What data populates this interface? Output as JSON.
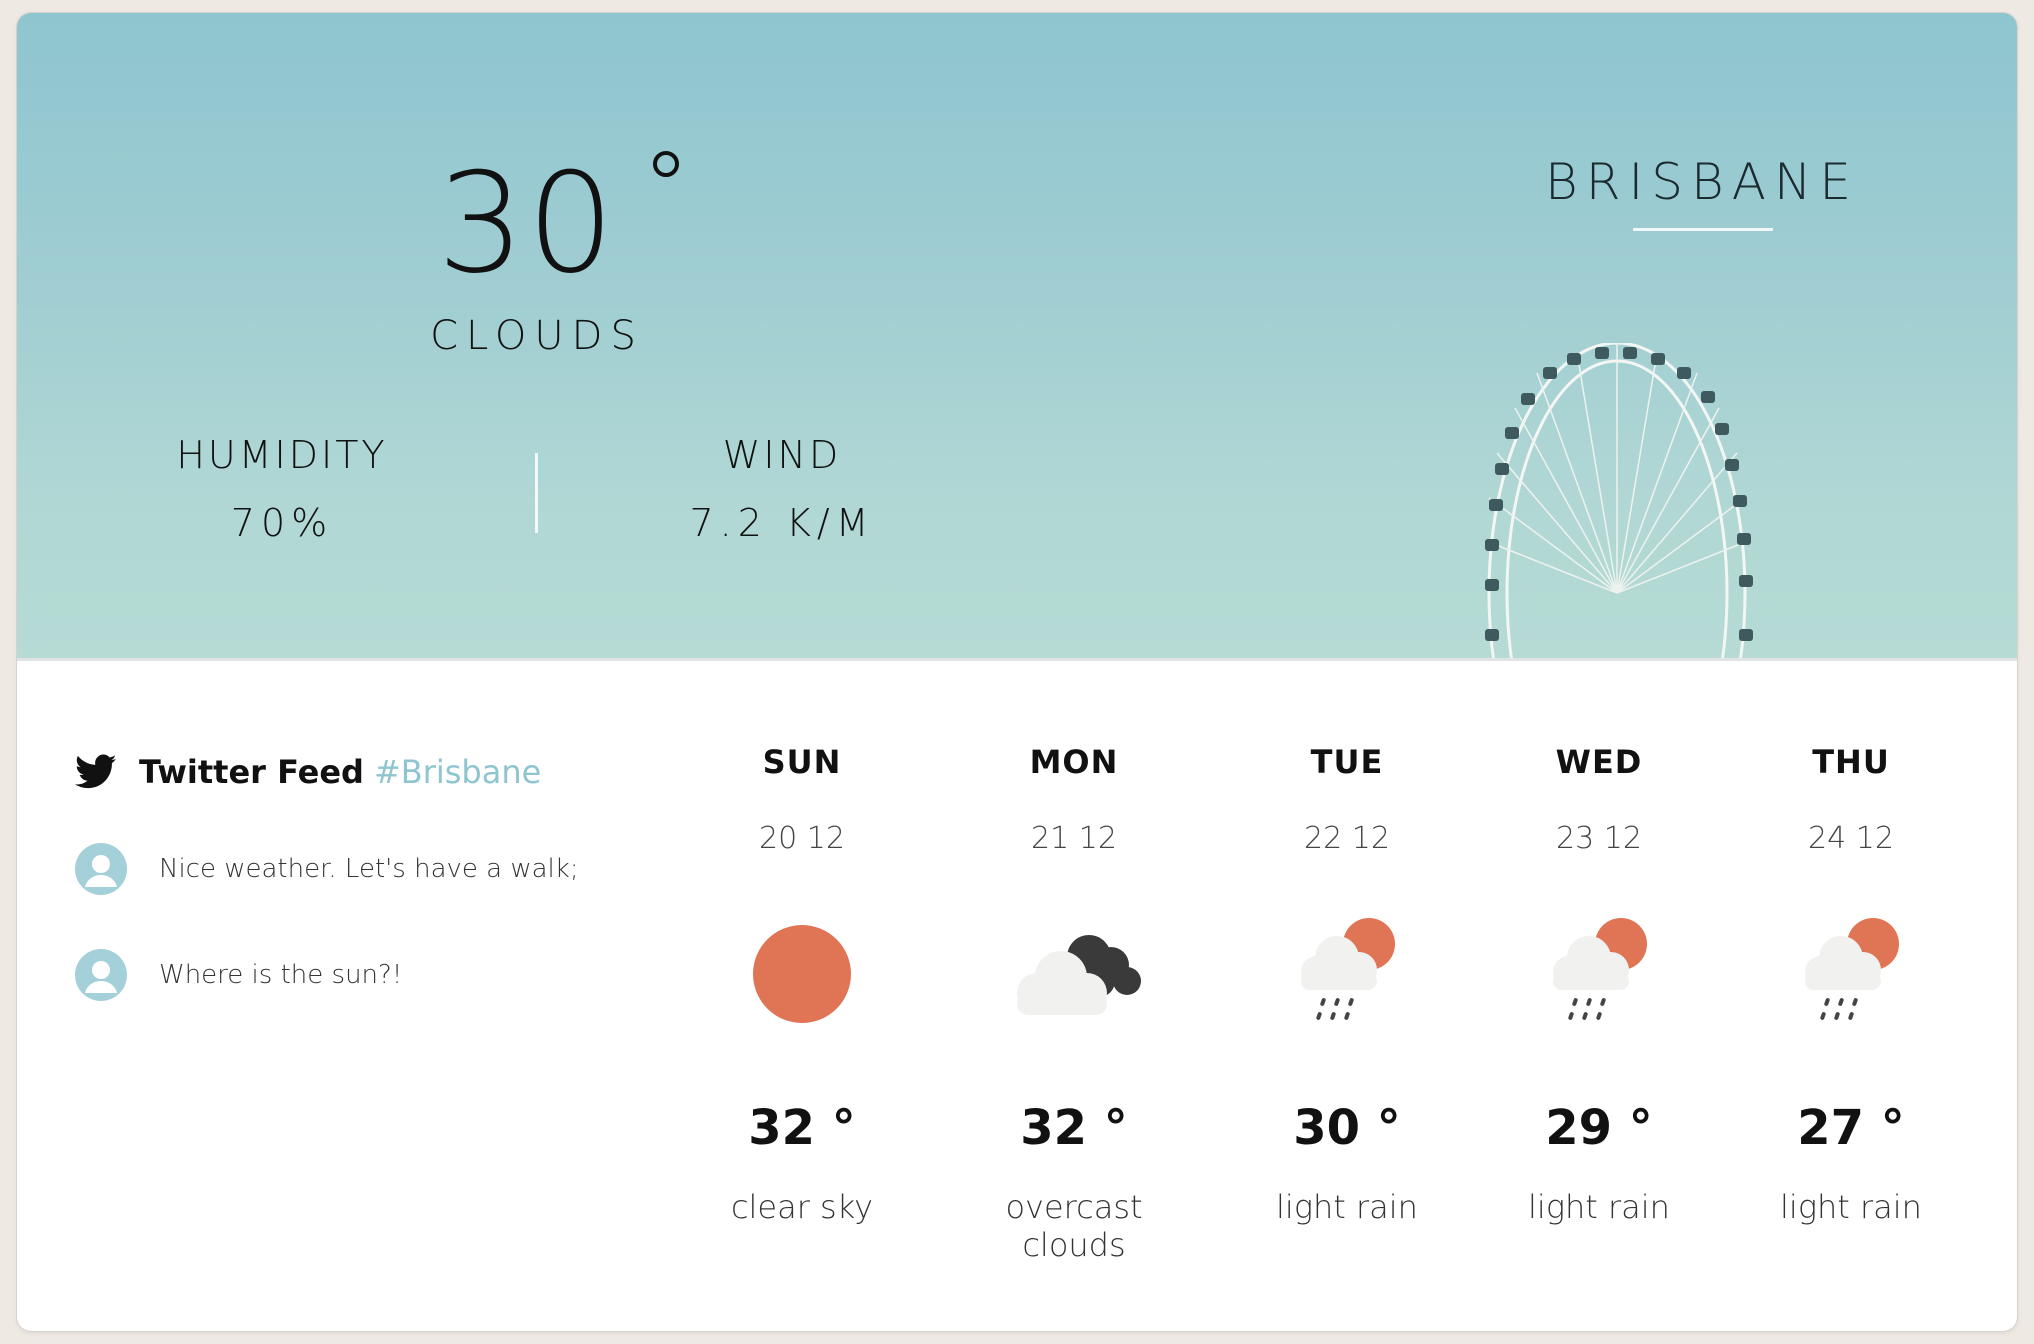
{
  "current": {
    "temperature": "30",
    "condition": "CLOUDS",
    "humidity_label": "HUMIDITY",
    "humidity_value": "70%",
    "wind_label": "WIND",
    "wind_value": "7.2 K/M",
    "city": "BRISBANE"
  },
  "twitter": {
    "title": "Twitter Feed",
    "hashtag": "#Brisbane",
    "tweets": [
      {
        "text": "Nice weather. Let's have a walk;"
      },
      {
        "text": "Where is the sun?!"
      }
    ]
  },
  "forecast": [
    {
      "day": "SUN",
      "date": "20 12",
      "temp": "32 °",
      "desc": "clear sky",
      "icon": "sun-icon"
    },
    {
      "day": "MON",
      "date": "21 12",
      "temp": "32 °",
      "desc": "overcast clouds",
      "icon": "overcast-clouds-icon"
    },
    {
      "day": "TUE",
      "date": "22 12",
      "temp": "30 °",
      "desc": "light rain",
      "icon": "light-rain-icon"
    },
    {
      "day": "WED",
      "date": "23 12",
      "temp": "29 °",
      "desc": "light rain",
      "icon": "light-rain-icon"
    },
    {
      "day": "THU",
      "date": "24 12",
      "temp": "27 °",
      "desc": "light rain",
      "icon": "light-rain-icon"
    }
  ],
  "colors": {
    "accent": "#8ec5cf",
    "sun": "#e07555",
    "sky_top": "#8ec5cf",
    "sky_bottom": "#b6dbd5"
  }
}
